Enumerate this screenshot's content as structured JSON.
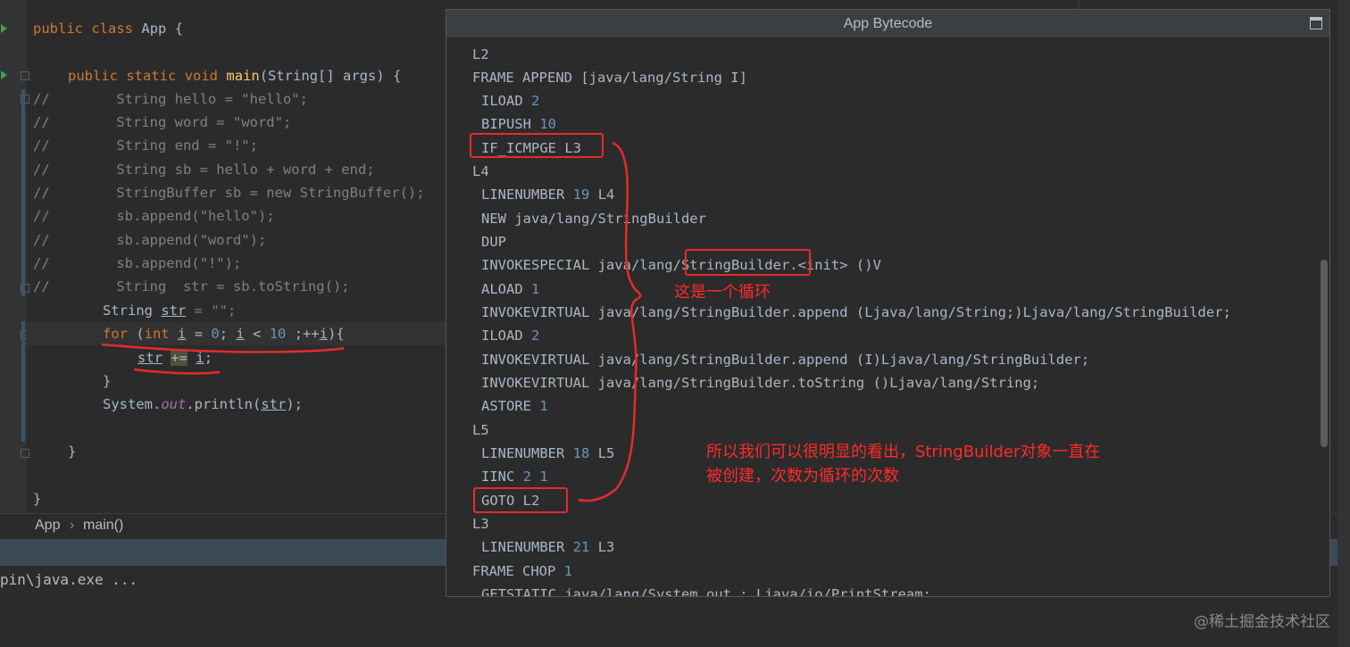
{
  "editor": {
    "lines": [
      {
        "text": "public class App {"
      },
      {
        "text": "public static void main(String[] args) {"
      },
      {
        "text": "//        String hello = \"hello\";"
      },
      {
        "text": "//        String word = \"word\";"
      },
      {
        "text": "//        String end = \"!\";"
      },
      {
        "text": "//        String sb = hello + word + end;"
      },
      {
        "text": "//        StringBuffer sb = new StringBuffer();"
      },
      {
        "text": "//        sb.append(\"hello\");"
      },
      {
        "text": "//        sb.append(\"word\");"
      },
      {
        "text": "//        sb.append(\"!\");"
      },
      {
        "text": "//        String  str = sb.toString();"
      }
    ],
    "tokens": {
      "public": "public",
      "class": "class",
      "app": "App",
      "brace": "{",
      "static": "static",
      "void": "void",
      "main": "main",
      "params": "(String[] args) {",
      "string": "String",
      "str": "str",
      "assign_empty": " = \"\";",
      "for": "for",
      "int": "int",
      "i": "i",
      "zero": "0",
      "ten": "10",
      "plus_eq": "+=",
      "close_brace": "}",
      "system": "System.",
      "out": "out",
      "println": ".println(",
      "close_call": ");"
    }
  },
  "breadcrumb": {
    "items": [
      "App",
      "main()"
    ],
    "separator": "›"
  },
  "run": {
    "command": "pin\\java.exe ..."
  },
  "popup": {
    "title": "App Bytecode",
    "lines": [
      {
        "label": "L2"
      },
      {
        "text": "FRAME APPEND [java/lang/String I]"
      },
      {
        "op": "ILOAD",
        "arg": "2"
      },
      {
        "op": "BIPUSH",
        "arg": "10"
      },
      {
        "op": "IF_ICMPGE L3"
      },
      {
        "label": "L4"
      },
      {
        "op": "LINENUMBER",
        "arg": "19",
        "tail": "L4"
      },
      {
        "op": "NEW java/lang/StringBuilder"
      },
      {
        "op": "DUP"
      },
      {
        "op": "INVOKESPECIAL java/lang/StringBuilder.<init> ()V"
      },
      {
        "op": "ALOAD",
        "arg": "1"
      },
      {
        "op": "INVOKEVIRTUAL java/lang/StringBuilder.append (Ljava/lang/String;)Ljava/lang/StringBuilder;"
      },
      {
        "op": "ILOAD",
        "arg": "2"
      },
      {
        "op": "INVOKEVIRTUAL java/lang/StringBuilder.append (I)Ljava/lang/StringBuilder;"
      },
      {
        "op": "INVOKEVIRTUAL java/lang/StringBuilder.toString ()Ljava/lang/String;"
      },
      {
        "op": "ASTORE",
        "arg": "1"
      },
      {
        "label": "L5"
      },
      {
        "op": "LINENUMBER",
        "arg": "18",
        "tail": "L5"
      },
      {
        "op": "IINC",
        "arg": "2 1"
      },
      {
        "op": "GOTO L2"
      },
      {
        "label": "L3"
      },
      {
        "op": "LINENUMBER",
        "arg": "21",
        "tail": "L3"
      },
      {
        "text": "FRAME CHOP",
        "arg": "1"
      },
      {
        "op": "GETSTATIC java/lang/System.out : Ljava/io/PrintStream;"
      }
    ]
  },
  "annotations": {
    "loop_note": "这是一个循环",
    "explain_line1": "所以我们可以很明显的看出，StringBuilder对象一直在",
    "explain_line2": "被创建，次数为循环的次数",
    "color": "#e52b2b"
  },
  "watermark": "@稀土掘金技术社区"
}
